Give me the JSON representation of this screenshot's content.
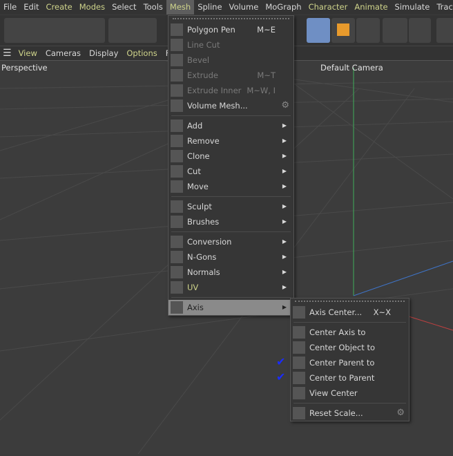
{
  "menubar": [
    "File",
    "Edit",
    "Create",
    "Modes",
    "Select",
    "Tools",
    "Mesh",
    "Spline",
    "Volume",
    "MoGraph",
    "Character",
    "Animate",
    "Simulate",
    "Tracker"
  ],
  "viewbar": [
    "View",
    "Cameras",
    "Display",
    "Options",
    "Filter"
  ],
  "viewport": {
    "label": "Perspective",
    "camera": "Default Camera"
  },
  "mesh_menu": {
    "items": [
      {
        "label": "Polygon Pen",
        "shortcut": "M~E"
      },
      {
        "label": "Line Cut",
        "shortcut": "",
        "disabled": true
      },
      {
        "label": "Bevel",
        "shortcut": "",
        "disabled": true
      },
      {
        "label": "Extrude",
        "shortcut": "M~T",
        "disabled": true
      },
      {
        "label": "Extrude Inner",
        "shortcut": "M~W, I",
        "disabled": true
      },
      {
        "label": "Volume Mesh...",
        "gear": true
      },
      {
        "sep": true
      },
      {
        "label": "Add",
        "sub": true
      },
      {
        "label": "Remove",
        "sub": true
      },
      {
        "label": "Clone",
        "sub": true
      },
      {
        "label": "Cut",
        "sub": true
      },
      {
        "label": "Move",
        "sub": true
      },
      {
        "sep": true
      },
      {
        "label": "Sculpt",
        "sub": true
      },
      {
        "label": "Brushes",
        "sub": true
      },
      {
        "sep": true
      },
      {
        "label": "Conversion",
        "sub": true
      },
      {
        "label": "N-Gons",
        "sub": true
      },
      {
        "label": "Normals",
        "sub": true
      },
      {
        "label": "UV",
        "sub": true,
        "hl": true
      },
      {
        "sep": true
      },
      {
        "label": "Axis",
        "sub": true,
        "active": true
      }
    ]
  },
  "axis_menu": {
    "items": [
      {
        "label": "Axis Center...",
        "shortcut": "X~X"
      },
      {
        "sep": true
      },
      {
        "label": "Center Axis to"
      },
      {
        "label": "Center Object to"
      },
      {
        "label": "Center Parent to",
        "checked": true
      },
      {
        "label": "Center to Parent",
        "checked": true
      },
      {
        "label": "View Center"
      },
      {
        "sep": true
      },
      {
        "label": "Reset Scale...",
        "gear": true
      }
    ]
  },
  "colors": {
    "accent": "#cfd48b",
    "selected_tool": "#6f8fc4",
    "check": "#1a2cff",
    "y_axis": "#3fae5a",
    "x_axis": "#c04040",
    "z_axis": "#3f74c8"
  }
}
